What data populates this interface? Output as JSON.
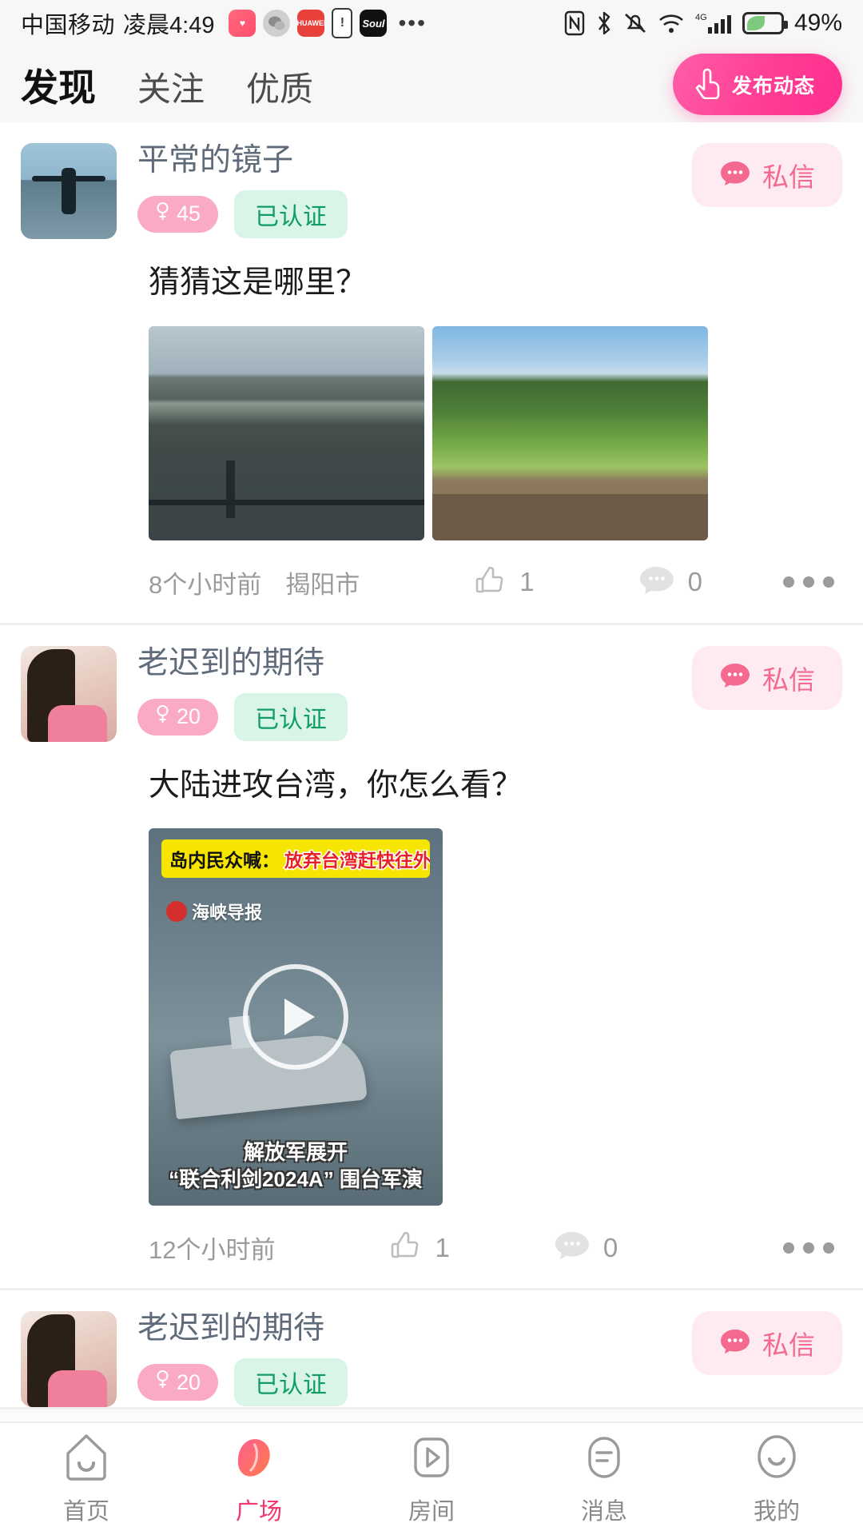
{
  "status_bar": {
    "carrier": "中国移动",
    "time": "凌晨4:49",
    "app_icons": [
      "heart-app-icon",
      "wechat-icon",
      "huawei-icon",
      "alert-icon",
      "soul-icon"
    ],
    "overflow": "•••",
    "icons": [
      "nfc-icon",
      "bluetooth-icon",
      "mute-icon",
      "wifi-icon",
      "4g-icon",
      "signal-icon",
      "battery-icon"
    ],
    "network_type": "4G",
    "battery_percent": "49%"
  },
  "header": {
    "tabs": [
      {
        "label": "发现",
        "active": true
      },
      {
        "label": "关注",
        "active": false
      },
      {
        "label": "优质",
        "active": false
      }
    ],
    "publish_button": {
      "label": "发布动态",
      "icon": "hand-tap-icon",
      "color": "#ff3d94"
    }
  },
  "feed": {
    "posts": [
      {
        "avatar": "user-photo-man-on-bridge",
        "username": "平常的镜子",
        "gender_badge": {
          "icon": "female-icon",
          "age": "45"
        },
        "verified_badge": "已认证",
        "pm_button": {
          "label": "私信",
          "icon": "chat-bubble-icon"
        },
        "text": "猜猜这是哪里？",
        "media_type": "photos",
        "photos": [
          "lake-mountain-photo",
          "green-field-dock-photo"
        ],
        "time": "8个小时前",
        "location": "揭阳市",
        "likes": "1",
        "comments": "0",
        "more": "more-options-icon"
      },
      {
        "avatar": "user-photo-woman-pink-top",
        "username": "老迟到的期待",
        "gender_badge": {
          "icon": "female-icon",
          "age": "20"
        },
        "verified_badge": "已认证",
        "pm_button": {
          "label": "私信",
          "icon": "chat-bubble-icon"
        },
        "text": "大陆进攻台湾，你怎么看？",
        "media_type": "video",
        "video": {
          "banner_prefix": "岛内民众喊：",
          "banner_highlight": "放弃台湾赶快往外跑",
          "watermark": "海峡导报",
          "caption_line1": "解放军展开",
          "caption_line2": "“联合利剑2024A” 围台军演",
          "play_icon": "play-icon"
        },
        "time": "12个小时前",
        "location": "",
        "likes": "1",
        "comments": "0",
        "more": "more-options-icon"
      },
      {
        "avatar": "user-photo-woman-pink-top",
        "username": "老迟到的期待",
        "gender_badge": {
          "icon": "female-icon",
          "age": "20"
        },
        "verified_badge": "已认证",
        "pm_button": {
          "label": "私信",
          "icon": "chat-bubble-icon"
        },
        "text": "",
        "media_type": "none",
        "time": "",
        "location": "",
        "likes": "",
        "comments": "",
        "more": "more-options-icon"
      }
    ]
  },
  "bottom_nav": {
    "items": [
      {
        "label": "首页",
        "icon": "home-icon",
        "active": false
      },
      {
        "label": "广场",
        "icon": "plaza-icon",
        "active": true
      },
      {
        "label": "房间",
        "icon": "room-play-icon",
        "active": false
      },
      {
        "label": "消息",
        "icon": "message-icon",
        "active": false
      },
      {
        "label": "我的",
        "icon": "profile-icon",
        "active": false
      }
    ],
    "active_color": "#f2376f"
  }
}
